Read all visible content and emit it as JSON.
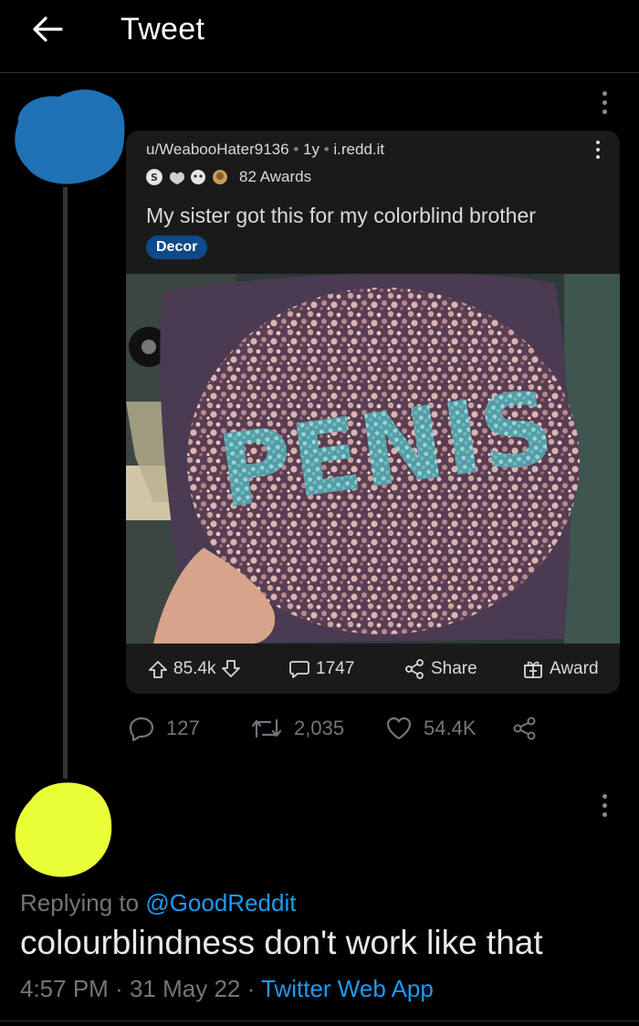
{
  "header": {
    "title": "Tweet"
  },
  "reddit_post": {
    "author": "u/WeabooHater9136",
    "age": "1y",
    "domain": "i.redd.it",
    "awards_text": "82 Awards",
    "title": "My sister got this for my colorblind brother",
    "flair": "Decor",
    "image_text": "PENIS",
    "upvotes": "85.4k",
    "comments": "1747",
    "share_label": "Share",
    "award_label": "Award"
  },
  "tweet_actions": {
    "replies": "127",
    "retweets": "2,035",
    "likes": "54.4K"
  },
  "reply_tweet": {
    "replying_prefix": "Replying to",
    "replying_handle": "@GoodReddit",
    "text": "colourblindness don't work like that",
    "time": "4:57 PM",
    "date": "31 May 22",
    "source": "Twitter Web App"
  },
  "colors": {
    "background": "#000000",
    "accent": "#1d9bf0",
    "muted": "#71767b",
    "censor_blue": "#1f72b6",
    "censor_yellow": "#eaff38"
  },
  "icons": [
    "back-arrow-icon",
    "more-icon",
    "upvote-icon",
    "downvote-icon",
    "comment-icon",
    "share-icon",
    "award-icon",
    "reply-icon",
    "retweet-icon",
    "like-icon"
  ]
}
